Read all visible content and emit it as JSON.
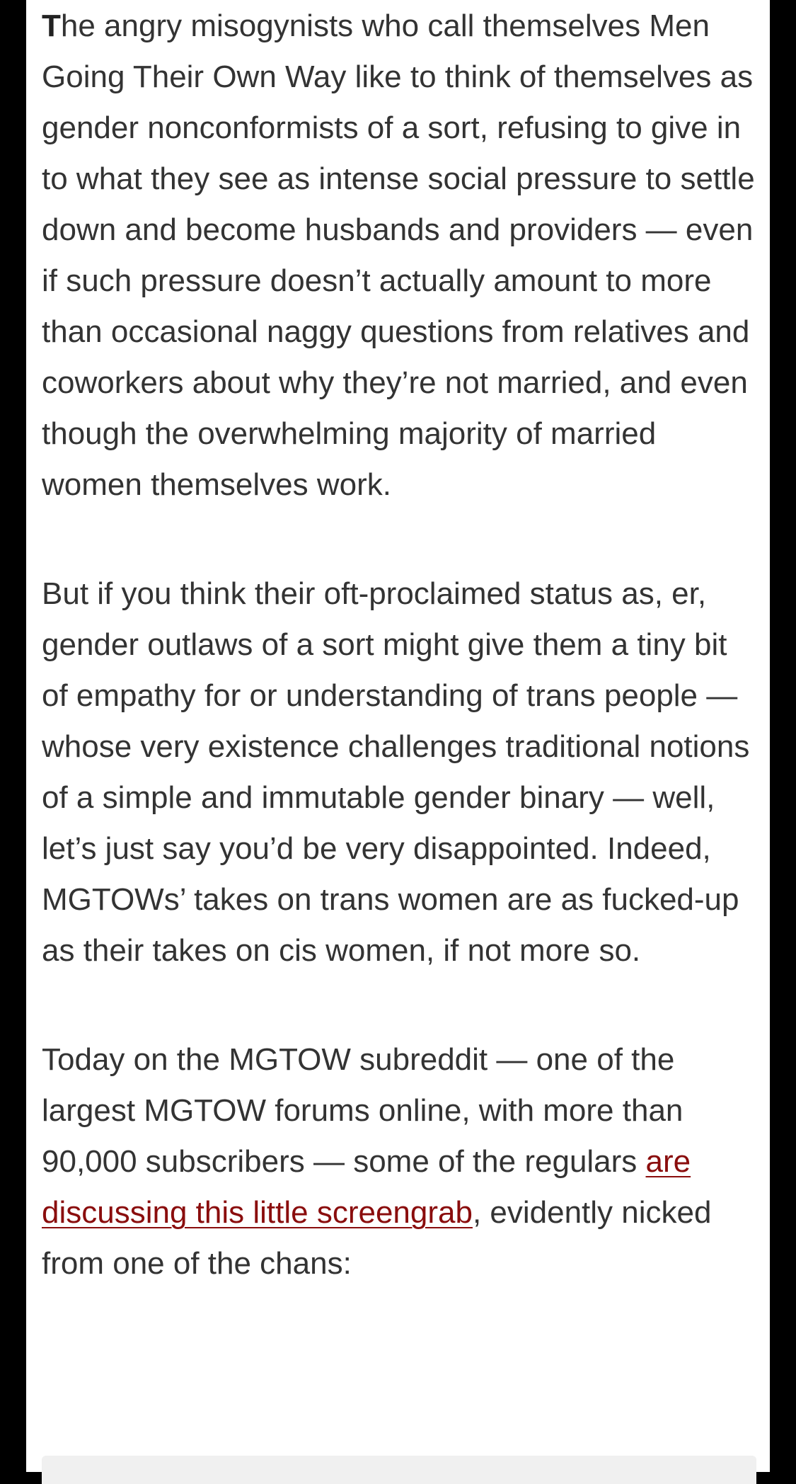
{
  "article": {
    "paragraph1": {
      "dropcap": "T",
      "text": "he angry misogynists who call themselves Men Going Their Own Way like to think of themselves as gender nonconformists of a sort, refusing to give in to what they see as intense social pressure to settle down and become husbands and providers — even if such pressure doesn’t actually amount to more than occasional naggy questions from relatives and coworkers about why they’re not married, and even though the overwhelming majority of married women themselves work."
    },
    "paragraph2": "But if you think their oft-proclaimed status as, er, gender outlaws of a sort might give them a tiny bit of empathy for or understanding of trans people — whose very existence challenges traditional notions of a simple and immutable gender binary — well, let’s just say you’d be very disappointed. Indeed, MGTOWs’ takes on trans women are as fucked-up as their takes on cis women, if not more so.",
    "paragraph3": {
      "before_link": "Today on the MGTOW subreddit — one of the largest MGTOW forums online, with more than 90,000 subscribers — some of the regulars ",
      "link_text": "are discussing this little screengrab",
      "after_link": ", evidently nicked from one of the chans:"
    }
  },
  "colors": {
    "background": "#000000",
    "page": "#ffffff",
    "text": "#333333",
    "link": "#8a0d0d",
    "embed": "#f0f0f0"
  }
}
